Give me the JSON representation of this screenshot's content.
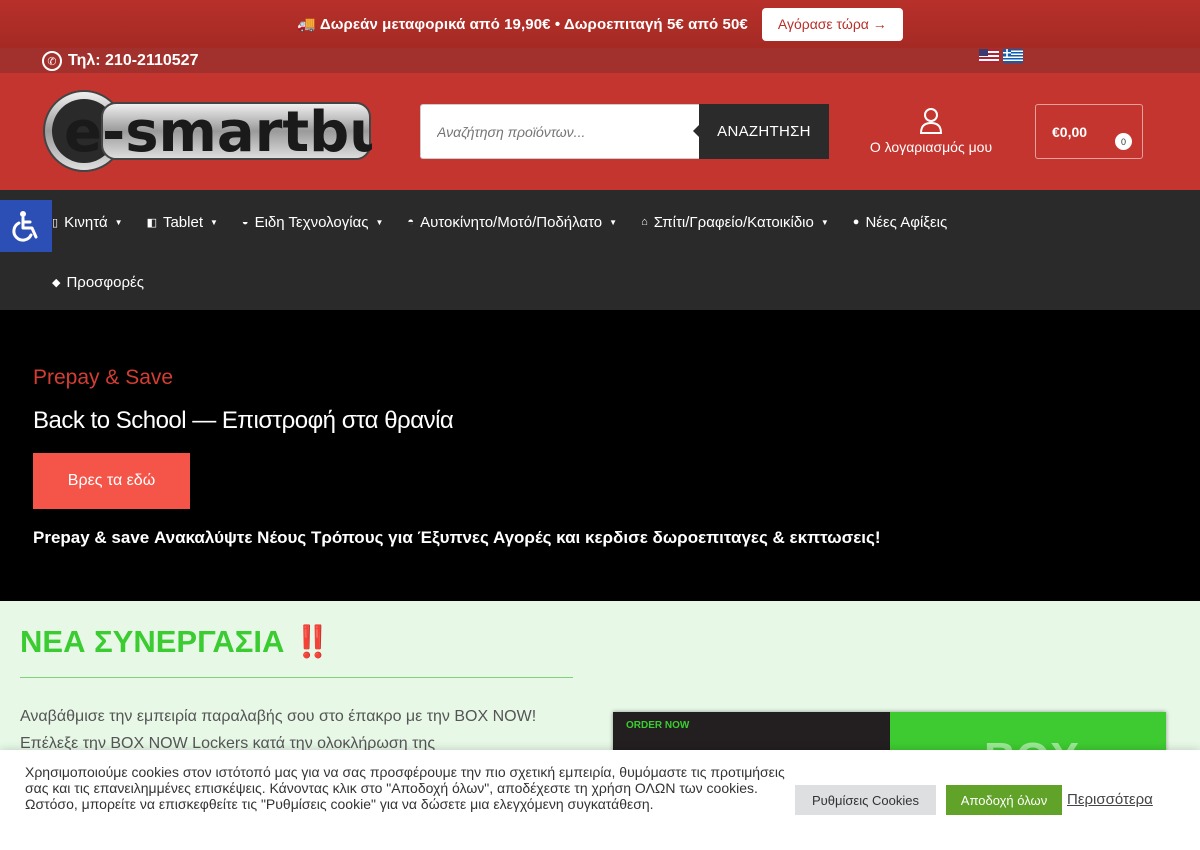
{
  "promo": {
    "text": "Δωρεάν μεταφορικά από 19,90€  •  Δωροεπιταγή 5€ από 50€",
    "button": "Αγόρασε τώρα →"
  },
  "contact": {
    "phone": "Τηλ: 210-2110527"
  },
  "header": {
    "logo_text": "e-smartbuy",
    "search_placeholder": "Αναζήτηση προϊόντων...",
    "search_button": "ΑΝΑΖΗΤΗΣΗ",
    "account_label": "Ο λογαριασμός μου",
    "cart_total": "€0,00",
    "cart_count": "0"
  },
  "nav": {
    "items": [
      {
        "label": "Κινητά",
        "icon": "phone-icon"
      },
      {
        "label": "Tablet",
        "icon": "tablet-icon"
      },
      {
        "label": "Ειδη Τεχνολογίας",
        "icon": "tech-icon"
      },
      {
        "label": "Αυτοκίνητο/Μοτό/Ποδήλατο",
        "icon": "car-icon"
      },
      {
        "label": "Σπίτι/Γραφείο/Κατοικίδιο",
        "icon": "home-icon"
      },
      {
        "label": "Νέες Αφίξεις",
        "icon": "alert-icon"
      },
      {
        "label": "Προσφορές",
        "icon": "tag-icon"
      }
    ]
  },
  "hero": {
    "kicker": "Prepay & Save",
    "title": "Back to School — Επιστροφή στα θρανία",
    "button": "Βρες τα εδώ",
    "subtitle": "Prepay & save Ανακαλύψτε Νέους Τρόπους για Έξυπνες Αγορές και κερδισε δωροεπιταγες & εκπτωσεις!"
  },
  "partner": {
    "title": "ΝΕΑ ΣΥΝΕΡΓΑΣΙΑ ‼️",
    "text": "Αναβάθμισε την εμπειρία παραλαβής σου στο έπακρο με την BOX NOW! Επέλεξε την BOX NOW Lockers κατά την ολοκλήρωση της",
    "banner_left": "ORDER NOW",
    "banner_right": "BOX"
  },
  "cookie": {
    "text": "Χρησιμοποιούμε cookies στον ιστότοπό μας για να σας προσφέρουμε την πιο σχετική εμπειρία, θυμόμαστε τις προτιμήσεις σας και τις επανειλημμένες επισκέψεις. Κάνοντας κλικ στο \"Αποδοχή όλων\", αποδέχεστε τη χρήση ΟΛΩΝ των cookies. Ωστόσο, μπορείτε να επισκεφθείτε τις \"Ρυθμίσεις cookie\" για να δώσετε μια ελεγχόμενη συγκατάθεση.",
    "settings_button": "Ρυθμίσεις Cookies",
    "accept_button": "Αποδοχή όλων",
    "more_link": "Περισσότερα"
  },
  "colors": {
    "brand_red": "#c5352f",
    "nav_dark": "#2a2a2a",
    "green": "#3bcc31",
    "hero_button": "#f55549"
  }
}
